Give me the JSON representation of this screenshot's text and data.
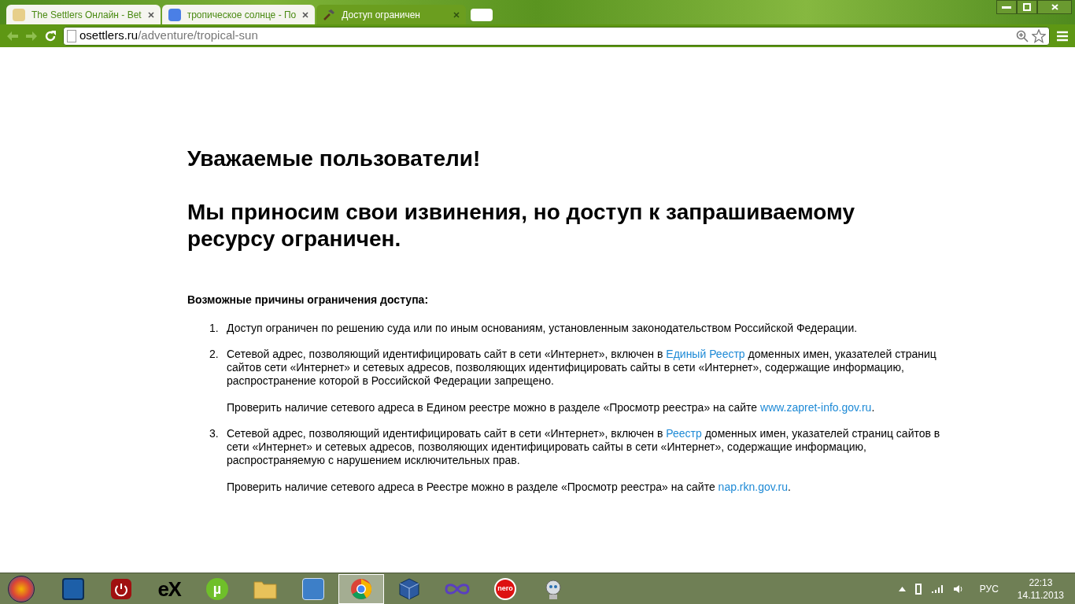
{
  "tabs": [
    {
      "title": "The Settlers Онлайн - Bet",
      "selected": false,
      "kind": "settlers"
    },
    {
      "title": "тропическое солнце - По",
      "selected": false,
      "kind": "google"
    },
    {
      "title": "Доступ ограничен",
      "selected": true,
      "kind": "hammer"
    }
  ],
  "address_bar": {
    "domain": "osettlers.ru",
    "path": "/adventure/tropical-sun"
  },
  "page": {
    "heading_1": "Уважаемые пользователи!",
    "heading_2": "Мы приносим свои извинения, но доступ к запрашиваемому ресурсу ограничен.",
    "reasons_title": "Возможные причины ограничения доступа:",
    "reasons": [
      {
        "number": "1.",
        "paragraphs": [
          {
            "before": "Доступ ограничен  по решению суда или по иным основаниям, установленным законодательством Российской Федерации."
          }
        ]
      },
      {
        "number": "2.",
        "paragraphs": [
          {
            "before": "Сетевой адрес, позволяющий идентифицировать сайт в сети «Интернет», включен в ",
            "link": "Единый Реестр",
            "after": " доменных имен, указателей страниц сайтов сети «Интернет» и сетевых адресов, позволяющих идентифицировать сайты в сети «Интернет», содержащие информацию, распространение которой в Российской Федерации запрещено."
          },
          {
            "before": "Проверить наличие сетевого адреса в Едином реестре можно в разделе «Просмотр реестра» на сайте ",
            "link": "www.zapret-info.gov.ru",
            "after": "."
          }
        ]
      },
      {
        "number": "3.",
        "paragraphs": [
          {
            "before": "Сетевой адрес, позволяющий идентифицировать сайт в сети «Интернет», включен в ",
            "link": "Реестр",
            "after": " доменных имен, указателей страниц сайтов в сети «Интернет» и сетевых адресов, позволяющих идентифицировать сайты в сети «Интернет», содержащие информацию, распространяемую с нарушением исключительных прав."
          },
          {
            "before": "Проверить наличие сетевого адреса в Реестре можно в разделе «Просмотр реестра» на сайте ",
            "link": "nap.rkn.gov.ru",
            "after": "."
          }
        ]
      }
    ]
  },
  "taskbar": {
    "apps": [
      {
        "kind": "docs",
        "selected": false
      },
      {
        "kind": "power",
        "selected": false
      },
      {
        "kind": "ex",
        "label": "eX",
        "selected": false
      },
      {
        "kind": "torrent",
        "label": "µ",
        "selected": false
      },
      {
        "kind": "folder",
        "selected": false
      },
      {
        "kind": "panel",
        "selected": false
      },
      {
        "kind": "chrome",
        "selected": true
      },
      {
        "kind": "box",
        "selected": false
      },
      {
        "kind": "infinity",
        "selected": false
      },
      {
        "kind": "nero",
        "label": "nero",
        "selected": false
      },
      {
        "kind": "robot",
        "selected": false
      }
    ],
    "language": "РУС",
    "time": "22:13",
    "date": "14.11.2013"
  }
}
